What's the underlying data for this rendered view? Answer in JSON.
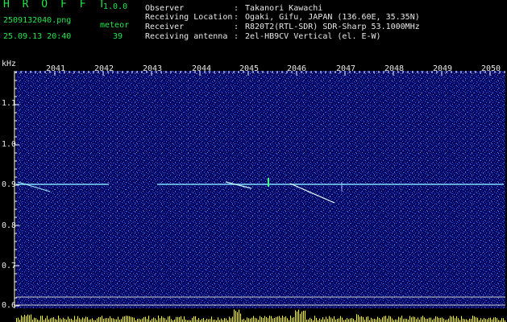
{
  "header": {
    "app_title": "H R O F F T",
    "app_version": "1.0.0",
    "file_name": "2509132040.png",
    "timestamp": "25.09.13 20:40",
    "count_label": "meteor",
    "count_value": "39"
  },
  "station": [
    {
      "label": "Observer",
      "value": "Takanori Kawachi"
    },
    {
      "label": "Receiving Location",
      "value": "Ogaki, Gifu, JAPAN (136.60E, 35.35N)"
    },
    {
      "label": "Receiver",
      "value": "R820T2(RTL-SDR) SDR-Sharp 53.1000MHz"
    },
    {
      "label": "Receiving antenna",
      "value": "2el-HB9CV Vertical (el. E-W)"
    }
  ],
  "separator": ":",
  "spectrogram": {
    "freq_unit": "kHz",
    "freq_ticks": [
      "1.1",
      "1.0",
      "0.9",
      "0.8",
      "0.7",
      "0.6"
    ],
    "time_ticks": [
      "2041",
      "2042",
      "2043",
      "2044",
      "2045",
      "2046",
      "2047",
      "2048",
      "2049",
      "2050"
    ],
    "colors": {
      "background": "#05055a",
      "noise_low": "#0a2ab4",
      "noise_high": "#3f7ce8",
      "carrier": "#8fe8ff",
      "meteor": "#ffffff",
      "level_bar": "#ffff00",
      "tick_grid": "#ffffff"
    }
  }
}
